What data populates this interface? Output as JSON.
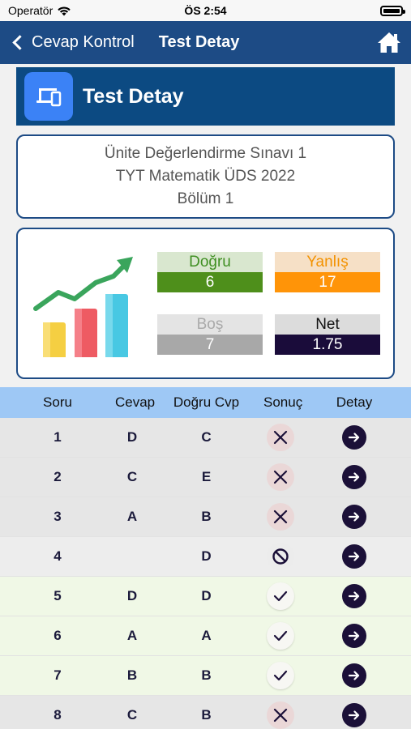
{
  "status": {
    "carrier": "Operatör",
    "time": "ÖS 2:54"
  },
  "nav": {
    "back_label": "Cevap Kontrol",
    "title": "Test Detay"
  },
  "header": {
    "title": "Test Detay"
  },
  "info": {
    "line1": "Ünite Değerlendirme Sınavı 1",
    "line2": "TYT Matematik ÜDS 2022",
    "line3": "Bölüm 1"
  },
  "stats": {
    "dogru": {
      "label": "Doğru",
      "value": "6"
    },
    "yanlis": {
      "label": "Yanlış",
      "value": "17"
    },
    "bos": {
      "label": "Boş",
      "value": "7"
    },
    "net": {
      "label": "Net",
      "value": "1.75"
    }
  },
  "table": {
    "headers": [
      "Soru",
      "Cevap",
      "Doğru Cvp",
      "Sonuç",
      "Detay"
    ],
    "rows": [
      {
        "soru": "1",
        "cevap": "D",
        "dogru": "C",
        "sonuc": "wrong"
      },
      {
        "soru": "2",
        "cevap": "C",
        "dogru": "E",
        "sonuc": "wrong"
      },
      {
        "soru": "3",
        "cevap": "A",
        "dogru": "B",
        "sonuc": "wrong"
      },
      {
        "soru": "4",
        "cevap": "",
        "dogru": "D",
        "sonuc": "empty"
      },
      {
        "soru": "5",
        "cevap": "D",
        "dogru": "D",
        "sonuc": "correct"
      },
      {
        "soru": "6",
        "cevap": "A",
        "dogru": "A",
        "sonuc": "correct"
      },
      {
        "soru": "7",
        "cevap": "B",
        "dogru": "B",
        "sonuc": "correct"
      },
      {
        "soru": "8",
        "cevap": "C",
        "dogru": "B",
        "sonuc": "wrong"
      }
    ]
  }
}
